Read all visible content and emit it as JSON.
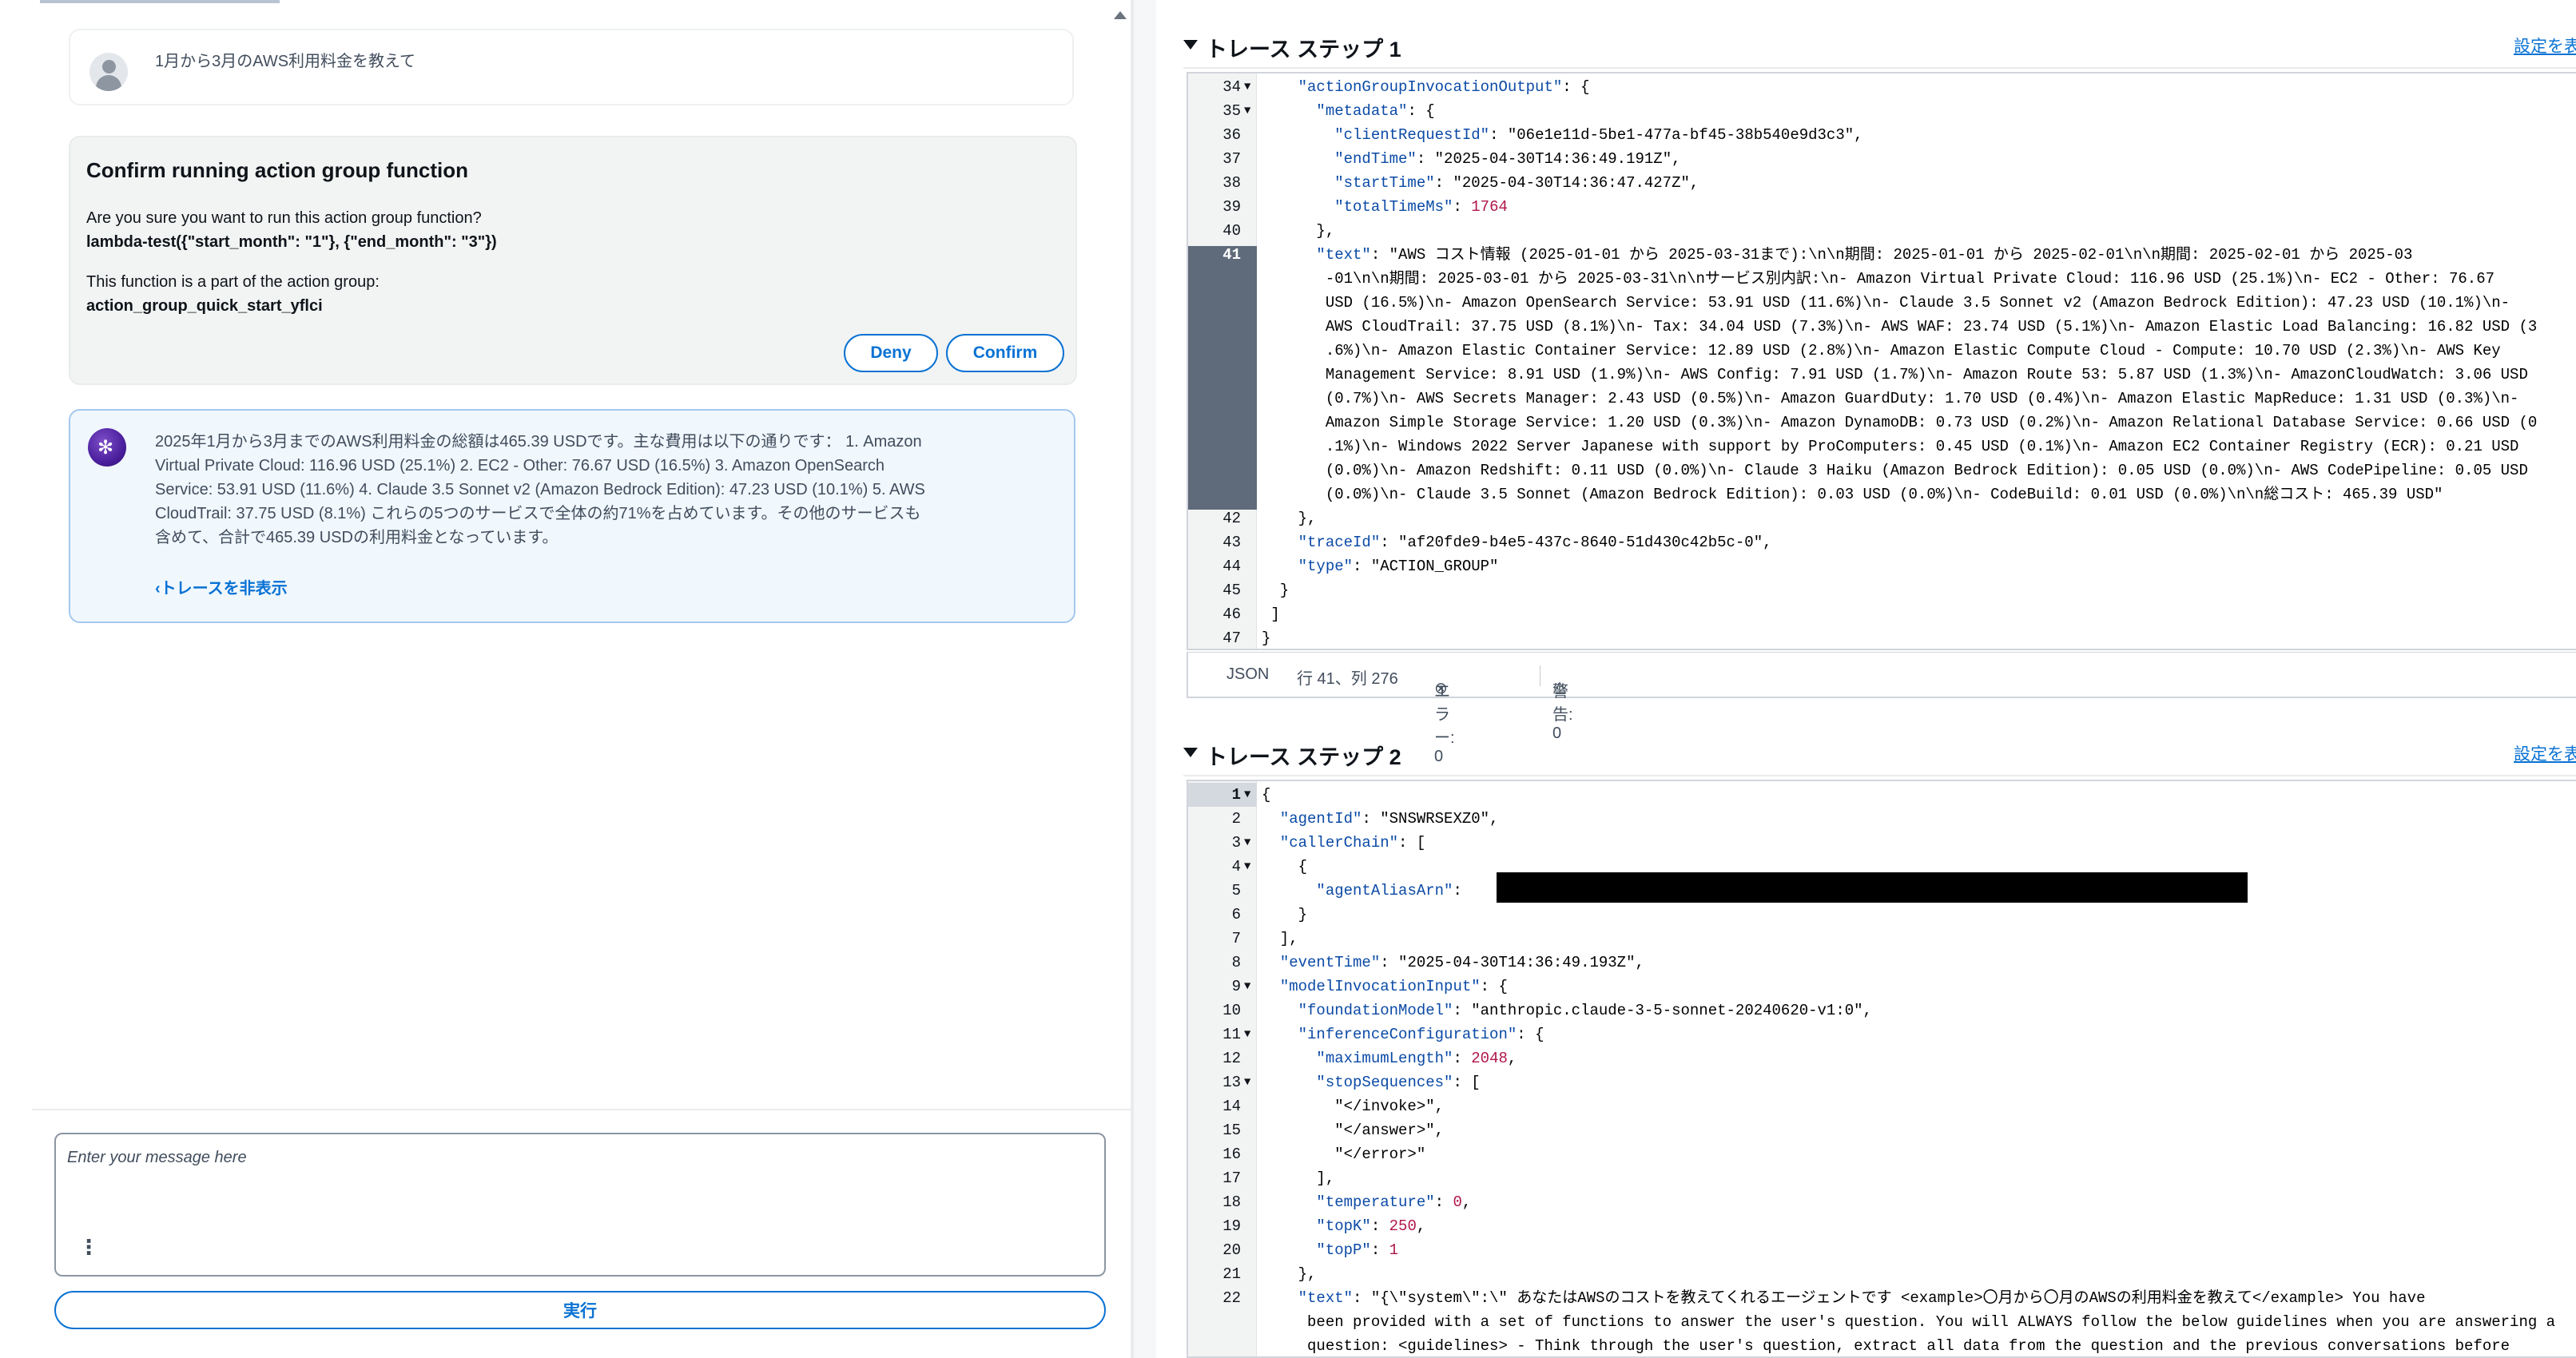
{
  "chat": {
    "user_message": "1月から3月のAWS利用料金を教えて",
    "confirm": {
      "title": "Confirm running action group function",
      "question": "Are you sure you want to run this action group function?",
      "function_call": "lambda-test({\"start_month\": \"1\"}, {\"end_month\": \"3\"})",
      "part_of": "This function is a part of the action group:",
      "group_name": "action_group_quick_start_yflci",
      "deny_label": "Deny",
      "confirm_label": "Confirm"
    },
    "agent_message_lines": [
      "2025年1月から3月までのAWS利用料金の総額は465.39 USDです。主な費用は以下の通りです： 1. Amazon",
      "Virtual Private Cloud: 116.96 USD (25.1%) 2. EC2 - Other: 76.67 USD (16.5%) 3. Amazon OpenSearch",
      "Service: 53.91 USD (11.6%) 4. Claude 3.5 Sonnet v2 (Amazon Bedrock Edition): 47.23 USD (10.1%) 5. AWS",
      "CloudTrail: 37.75 USD (8.1%) これらの5つのサービスで全体の約71%を占めています。その他のサービスも",
      "含めて、合計で465.39 USDの利用料金となっています。"
    ],
    "hide_trace_label": "トレースを非表示",
    "input_placeholder": "Enter your message here",
    "run_label": "実行"
  },
  "trace1": {
    "title": "トレース ステップ 1",
    "settings_label": "設定を表示",
    "lines": [
      {
        "n": "34",
        "fold": true,
        "text": "    \"actionGroupInvocationOutput\": {"
      },
      {
        "n": "35",
        "fold": true,
        "text": "      \"metadata\": {"
      },
      {
        "n": "36",
        "fold": false,
        "text": "        \"clientRequestId\": \"06e1e11d-5be1-477a-bf45-38b540e9d3c3\","
      },
      {
        "n": "37",
        "fold": false,
        "text": "        \"endTime\": \"2025-04-30T14:36:49.191Z\","
      },
      {
        "n": "38",
        "fold": false,
        "text": "        \"startTime\": \"2025-04-30T14:36:47.427Z\","
      },
      {
        "n": "39",
        "fold": false,
        "text": "        \"totalTimeMs\": 1764"
      },
      {
        "n": "40",
        "fold": false,
        "text": "      },"
      },
      {
        "n": "41",
        "fold": false,
        "text": "      \"text\": \"AWS コスト情報 (2025-01-01 から 2025-03-31まで):\\n\\n期間: 2025-01-01 から 2025-02-01\\n\\n期間: 2025-02-01 から 2025-03"
      },
      {
        "n": "",
        "fold": false,
        "text": "       -01\\n\\n期間: 2025-03-01 から 2025-03-31\\n\\nサービス別内訳:\\n- Amazon Virtual Private Cloud: 116.96 USD (25.1%)\\n- EC2 - Other: 76.67"
      },
      {
        "n": "",
        "fold": false,
        "text": "       USD (16.5%)\\n- Amazon OpenSearch Service: 53.91 USD (11.6%)\\n- Claude 3.5 Sonnet v2 (Amazon Bedrock Edition): 47.23 USD (10.1%)\\n-"
      },
      {
        "n": "",
        "fold": false,
        "text": "       AWS CloudTrail: 37.75 USD (8.1%)\\n- Tax: 34.04 USD (7.3%)\\n- AWS WAF: 23.74 USD (5.1%)\\n- Amazon Elastic Load Balancing: 16.82 USD (3"
      },
      {
        "n": "",
        "fold": false,
        "text": "       .6%)\\n- Amazon Elastic Container Service: 12.89 USD (2.8%)\\n- Amazon Elastic Compute Cloud - Compute: 10.70 USD (2.3%)\\n- AWS Key"
      },
      {
        "n": "",
        "fold": false,
        "text": "       Management Service: 8.91 USD (1.9%)\\n- AWS Config: 7.91 USD (1.7%)\\n- Amazon Route 53: 5.87 USD (1.3%)\\n- AmazonCloudWatch: 3.06 USD"
      },
      {
        "n": "",
        "fold": false,
        "text": "       (0.7%)\\n- AWS Secrets Manager: 2.43 USD (0.5%)\\n- Amazon GuardDuty: 1.70 USD (0.4%)\\n- Amazon Elastic MapReduce: 1.31 USD (0.3%)\\n-"
      },
      {
        "n": "",
        "fold": false,
        "text": "       Amazon Simple Storage Service: 1.20 USD (0.3%)\\n- Amazon DynamoDB: 0.73 USD (0.2%)\\n- Amazon Relational Database Service: 0.66 USD (0"
      },
      {
        "n": "",
        "fold": false,
        "text": "       .1%)\\n- Windows 2022 Server Japanese with support by ProComputers: 0.45 USD (0.1%)\\n- Amazon EC2 Container Registry (ECR): 0.21 USD"
      },
      {
        "n": "",
        "fold": false,
        "text": "       (0.0%)\\n- Amazon Redshift: 0.11 USD (0.0%)\\n- Claude 3 Haiku (Amazon Bedrock Edition): 0.05 USD (0.0%)\\n- AWS CodePipeline: 0.05 USD"
      },
      {
        "n": "",
        "fold": false,
        "text": "       (0.0%)\\n- Claude 3.5 Sonnet (Amazon Bedrock Edition): 0.03 USD (0.0%)\\n- CodeBuild: 0.01 USD (0.0%)\\n\\n総コスト: 465.39 USD\""
      },
      {
        "n": "42",
        "fold": false,
        "text": "    },"
      },
      {
        "n": "43",
        "fold": false,
        "text": "    \"traceId\": \"af20fde9-b4e5-437c-8640-51d430c42b5c-0\","
      },
      {
        "n": "44",
        "fold": false,
        "text": "    \"type\": \"ACTION_GROUP\""
      },
      {
        "n": "45",
        "fold": false,
        "text": "  }"
      },
      {
        "n": "46",
        "fold": false,
        "text": " ]"
      },
      {
        "n": "47",
        "fold": false,
        "text": "}"
      }
    ],
    "status": {
      "lang": "JSON",
      "position": "行 41、列 276",
      "errors": "エラー: 0",
      "warnings": "警告: 0"
    }
  },
  "trace2": {
    "title": "トレース ステップ 2",
    "settings_label": "設定を表示",
    "lines": [
      {
        "n": "1",
        "fold": true,
        "text": "{"
      },
      {
        "n": "2",
        "fold": false,
        "text": "  \"agentId\": \"SNSWRSEXZ0\","
      },
      {
        "n": "3",
        "fold": true,
        "text": "  \"callerChain\": ["
      },
      {
        "n": "4",
        "fold": true,
        "text": "    {"
      },
      {
        "n": "5",
        "fold": false,
        "text": "      \"agentAliasArn\":"
      },
      {
        "n": "6",
        "fold": false,
        "text": "    }"
      },
      {
        "n": "7",
        "fold": false,
        "text": "  ],"
      },
      {
        "n": "8",
        "fold": false,
        "text": "  \"eventTime\": \"2025-04-30T14:36:49.193Z\","
      },
      {
        "n": "9",
        "fold": true,
        "text": "  \"modelInvocationInput\": {"
      },
      {
        "n": "10",
        "fold": false,
        "text": "    \"foundationModel\": \"anthropic.claude-3-5-sonnet-20240620-v1:0\","
      },
      {
        "n": "11",
        "fold": true,
        "text": "    \"inferenceConfiguration\": {"
      },
      {
        "n": "12",
        "fold": false,
        "text": "      \"maximumLength\": 2048,"
      },
      {
        "n": "13",
        "fold": true,
        "text": "      \"stopSequences\": ["
      },
      {
        "n": "14",
        "fold": false,
        "text": "        \"</invoke>\","
      },
      {
        "n": "15",
        "fold": false,
        "text": "        \"</answer>\","
      },
      {
        "n": "16",
        "fold": false,
        "text": "        \"</error>\""
      },
      {
        "n": "17",
        "fold": false,
        "text": "      ],"
      },
      {
        "n": "18",
        "fold": false,
        "text": "      \"temperature\": 0,"
      },
      {
        "n": "19",
        "fold": false,
        "text": "      \"topK\": 250,"
      },
      {
        "n": "20",
        "fold": false,
        "text": "      \"topP\": 1"
      },
      {
        "n": "21",
        "fold": false,
        "text": "    },"
      },
      {
        "n": "22",
        "fold": false,
        "text": "    \"text\": \"{\\\"system\\\":\\\" あなたはAWSのコストを教えてくれるエージェントです <example>〇月から〇月のAWSの利用料金を教えて</example> You have"
      },
      {
        "n": "",
        "fold": false,
        "text": "     been provided with a set of functions to answer the user's question. You will ALWAYS follow the below guidelines when you are answering a"
      },
      {
        "n": "",
        "fold": false,
        "text": "     question: <guidelines> - Think through the user's question, extract all data from the question and the previous conversations before"
      }
    ]
  }
}
